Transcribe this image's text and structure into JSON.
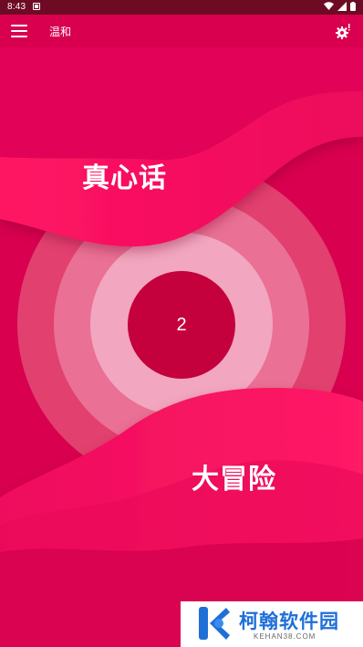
{
  "status_bar": {
    "time": "8:43",
    "icons": [
      "notification-icon",
      "wifi-icon",
      "signal-icon",
      "battery-icon"
    ]
  },
  "toolbar": {
    "menu_icon": "hamburger-menu-icon",
    "mode_label": "温和",
    "settings_icon": "settings-gear-icon"
  },
  "game": {
    "truth_label": "真心话",
    "dare_label": "大冒险",
    "count": "2"
  },
  "watermark": {
    "name": "柯翰软件园",
    "domain": "KEHAN38.COM"
  },
  "colors": {
    "background": "#d9004f",
    "accent_pink": "#ff1f66",
    "ring_light": "#f2a6c0",
    "center": "#c4003d",
    "status_bar": "#6e0b24",
    "watermark_blue": "#1f6fd8"
  }
}
